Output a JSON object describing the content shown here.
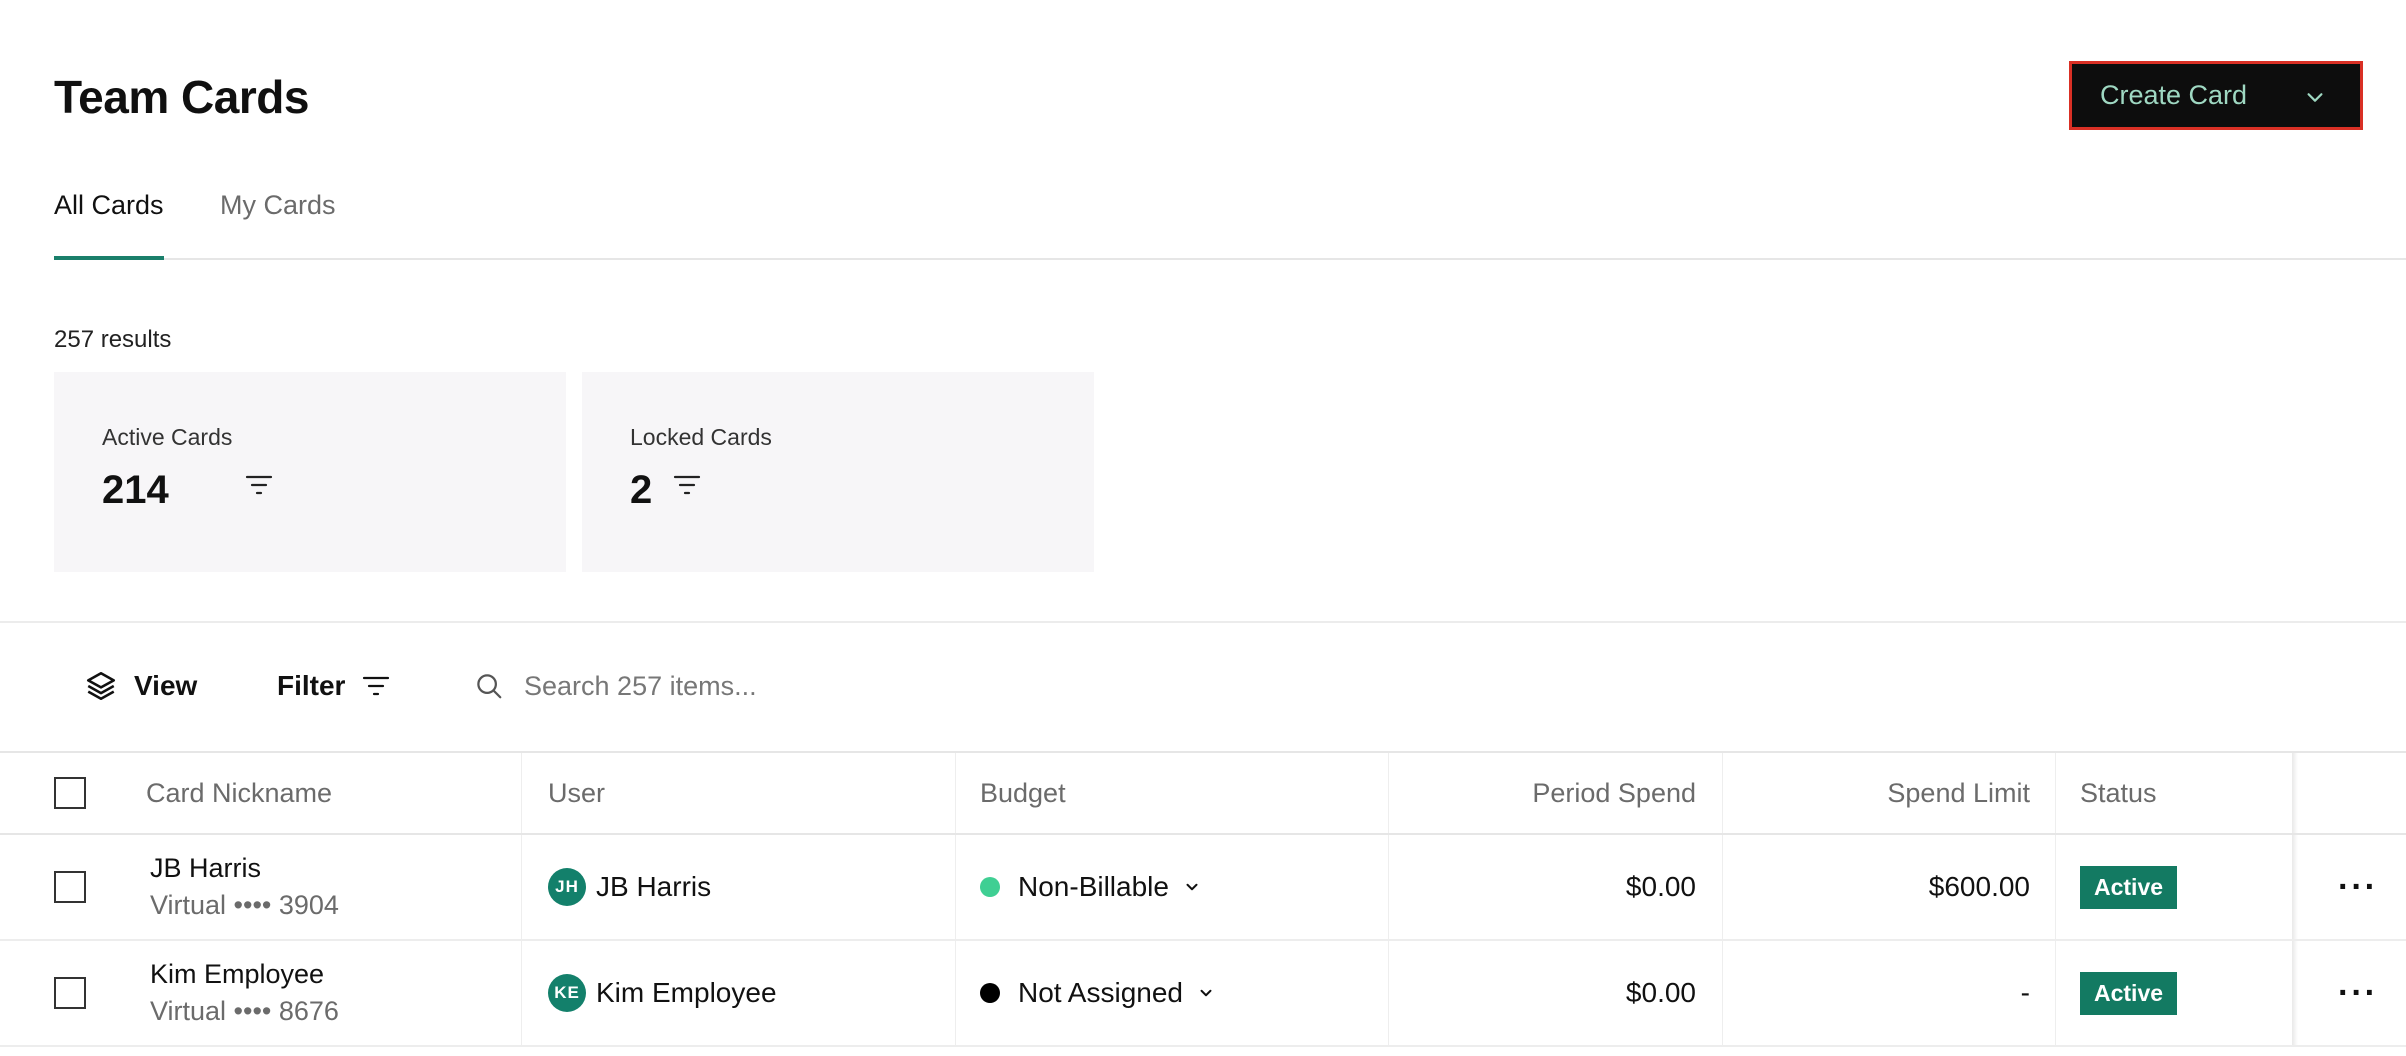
{
  "page": {
    "title": "Team Cards"
  },
  "header": {
    "create_label": "Create Card"
  },
  "tabs": [
    {
      "label": "All Cards",
      "active": true
    },
    {
      "label": "My Cards",
      "active": false
    }
  ],
  "results_text": "257 results",
  "stats": [
    {
      "label": "Active Cards",
      "value": "214"
    },
    {
      "label": "Locked Cards",
      "value": "2"
    }
  ],
  "toolbar": {
    "view_label": "View",
    "filter_label": "Filter",
    "search_placeholder": "Search 257 items..."
  },
  "table": {
    "columns": {
      "nickname": "Card Nickname",
      "user": "User",
      "budget": "Budget",
      "period_spend": "Period Spend",
      "spend_limit": "Spend Limit",
      "status": "Status"
    },
    "rows": [
      {
        "nickname": "JB Harris",
        "card": "Virtual •••• 3904",
        "user_initials": "JH",
        "user_name": "JB Harris",
        "budget": "Non-Billable",
        "budget_color": "#3fcf93",
        "period_spend": "$0.00",
        "spend_limit": "$600.00",
        "status": "Active",
        "more": "···"
      },
      {
        "nickname": "Kim Employee",
        "card": "Virtual •••• 8676",
        "user_initials": "KE",
        "user_name": "Kim Employee",
        "budget": "Not Assigned",
        "budget_color": "#000000",
        "period_spend": "$0.00",
        "spend_limit": "-",
        "status": "Active",
        "more": "···"
      }
    ]
  },
  "colors": {
    "accent": "#1a7f6b",
    "status_active": "#137a62",
    "create_button_bg": "#0d0d0d",
    "create_button_text": "#9fd8c2",
    "highlight_border": "#d93025"
  },
  "icons": {
    "create_chevron": "chevron-down-icon",
    "stat_filter": "filter-lines-icon",
    "view": "layers-icon",
    "filter": "filter-lines-icon",
    "search": "search-icon",
    "budget_chevron": "chevron-down-icon",
    "row_more": "more-horizontal-icon"
  }
}
